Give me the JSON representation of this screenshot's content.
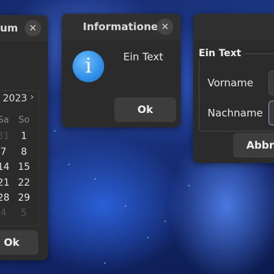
{
  "windows": {
    "calendar": {
      "title": "um",
      "year": "2023",
      "next": "›",
      "close": "×",
      "weekdays": [
        "Sa",
        "So"
      ],
      "weeks": [
        [
          "31",
          "1"
        ],
        [
          "7",
          "8"
        ],
        [
          "14",
          "15"
        ],
        [
          "21",
          "22"
        ],
        [
          "28",
          "29"
        ],
        [
          "4",
          "5"
        ]
      ],
      "ok_label": "Ok"
    },
    "info": {
      "title": "Informationen",
      "close": "×",
      "icon": "i",
      "message": "Ein Text",
      "ok_label": "Ok"
    },
    "form": {
      "group_title": "Ein Text",
      "first_name_label": "Vorname",
      "last_name_label": "Nachname",
      "cancel_label": "Abbre"
    }
  }
}
